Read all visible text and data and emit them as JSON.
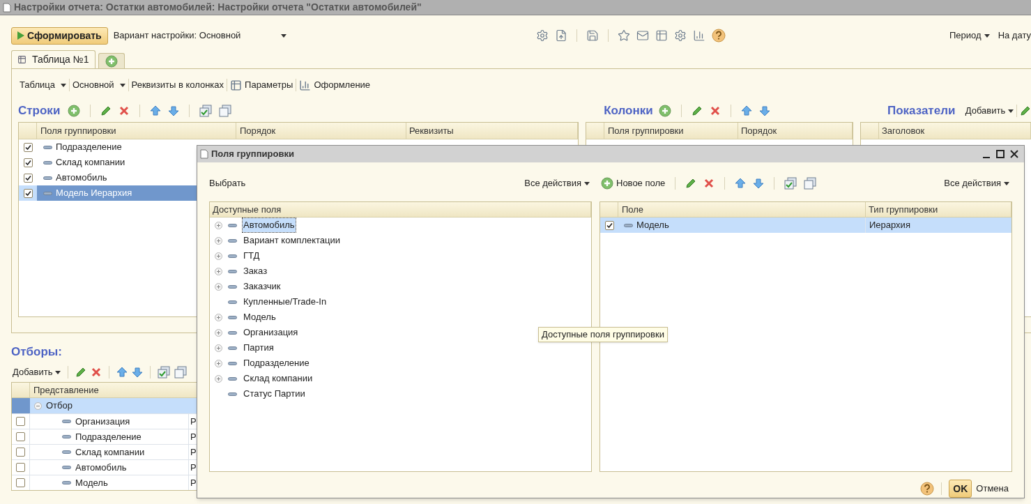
{
  "window": {
    "title": "Настройки отчета: Остатки автомобилей: Настройки отчета \"Остатки автомобилей\""
  },
  "toolbar": {
    "generate_button": "Сформировать",
    "variant": "Вариант настройки: Основной",
    "period": "Период",
    "on_date": "На дату"
  },
  "tabs": [
    {
      "label": "Таблица №1",
      "selected": true
    }
  ],
  "structure_toolbar": [
    {
      "kind": "menu",
      "label": "Таблица"
    },
    {
      "kind": "menu",
      "label": "Основной"
    },
    {
      "kind": "button",
      "label": "Реквизиты в колонках"
    },
    {
      "kind": "icon_button",
      "label": "Параметры"
    },
    {
      "kind": "icon_button",
      "label": "Оформление"
    }
  ],
  "rows_section": {
    "title": "Строки",
    "columns": [
      "Поля группировки",
      "Порядок",
      "Реквизиты"
    ],
    "rows": [
      {
        "label": "Подразделение",
        "checked": true,
        "selected": false
      },
      {
        "label": "Склад компании",
        "checked": true,
        "selected": false
      },
      {
        "label": "Автомобиль",
        "checked": true,
        "selected": false
      },
      {
        "label": "Модель Иерархия",
        "checked": true,
        "selected": true
      }
    ]
  },
  "columns_section": {
    "title": "Колонки",
    "columns": [
      "Поля группировки",
      "Порядок"
    ]
  },
  "indicators_section": {
    "title": "Показатели",
    "add_menu": "Добавить",
    "columns": [
      "Заголовок"
    ]
  },
  "filters": {
    "title": "Отборы:",
    "add_menu": "Добавить",
    "columns": [
      "Представление"
    ],
    "group": {
      "label": "Отбор",
      "expanded": true,
      "selected": true
    },
    "rows": [
      {
        "label": "Организация",
        "checked": false,
        "column_2": "Р"
      },
      {
        "label": "Подразделение",
        "checked": false,
        "column_2": "Р"
      },
      {
        "label": "Склад компании",
        "checked": false,
        "column_2": "Р"
      },
      {
        "label": "Автомобиль",
        "checked": false,
        "column_2": "Р"
      },
      {
        "label": "Модель",
        "checked": false,
        "column_2": "Р"
      }
    ]
  },
  "dialog": {
    "title": "Поля группировки",
    "select_label": "Выбрать",
    "left_actions": "Все действия",
    "new_field": "Новое поле",
    "right_actions": "Все действия",
    "available": {
      "header": "Доступные поля",
      "items": [
        {
          "label": "Автомобиль",
          "expandable": true,
          "selected": true
        },
        {
          "label": "Вариант комплектации",
          "expandable": true,
          "selected": false
        },
        {
          "label": "ГТД",
          "expandable": true,
          "selected": false
        },
        {
          "label": "Заказ",
          "expandable": true,
          "selected": false
        },
        {
          "label": "Заказчик",
          "expandable": true,
          "selected": false
        },
        {
          "label": "Купленные/Trade-In",
          "expandable": false,
          "selected": false
        },
        {
          "label": "Модель",
          "expandable": true,
          "selected": false
        },
        {
          "label": "Организация",
          "expandable": true,
          "selected": false
        },
        {
          "label": "Партия",
          "expandable": true,
          "selected": false
        },
        {
          "label": "Подразделение",
          "expandable": true,
          "selected": false
        },
        {
          "label": "Склад компании",
          "expandable": true,
          "selected": false
        },
        {
          "label": "Статус Партии",
          "expandable": false,
          "selected": false
        }
      ]
    },
    "selected_fields": {
      "columns": [
        "Поле",
        "Тип группировки"
      ],
      "rows": [
        {
          "field": "Модель",
          "type": "Иерархия",
          "checked": true,
          "selected": true
        }
      ]
    },
    "tooltip": "Доступные поля группировки",
    "ok": "OK",
    "cancel": "Отмена"
  }
}
